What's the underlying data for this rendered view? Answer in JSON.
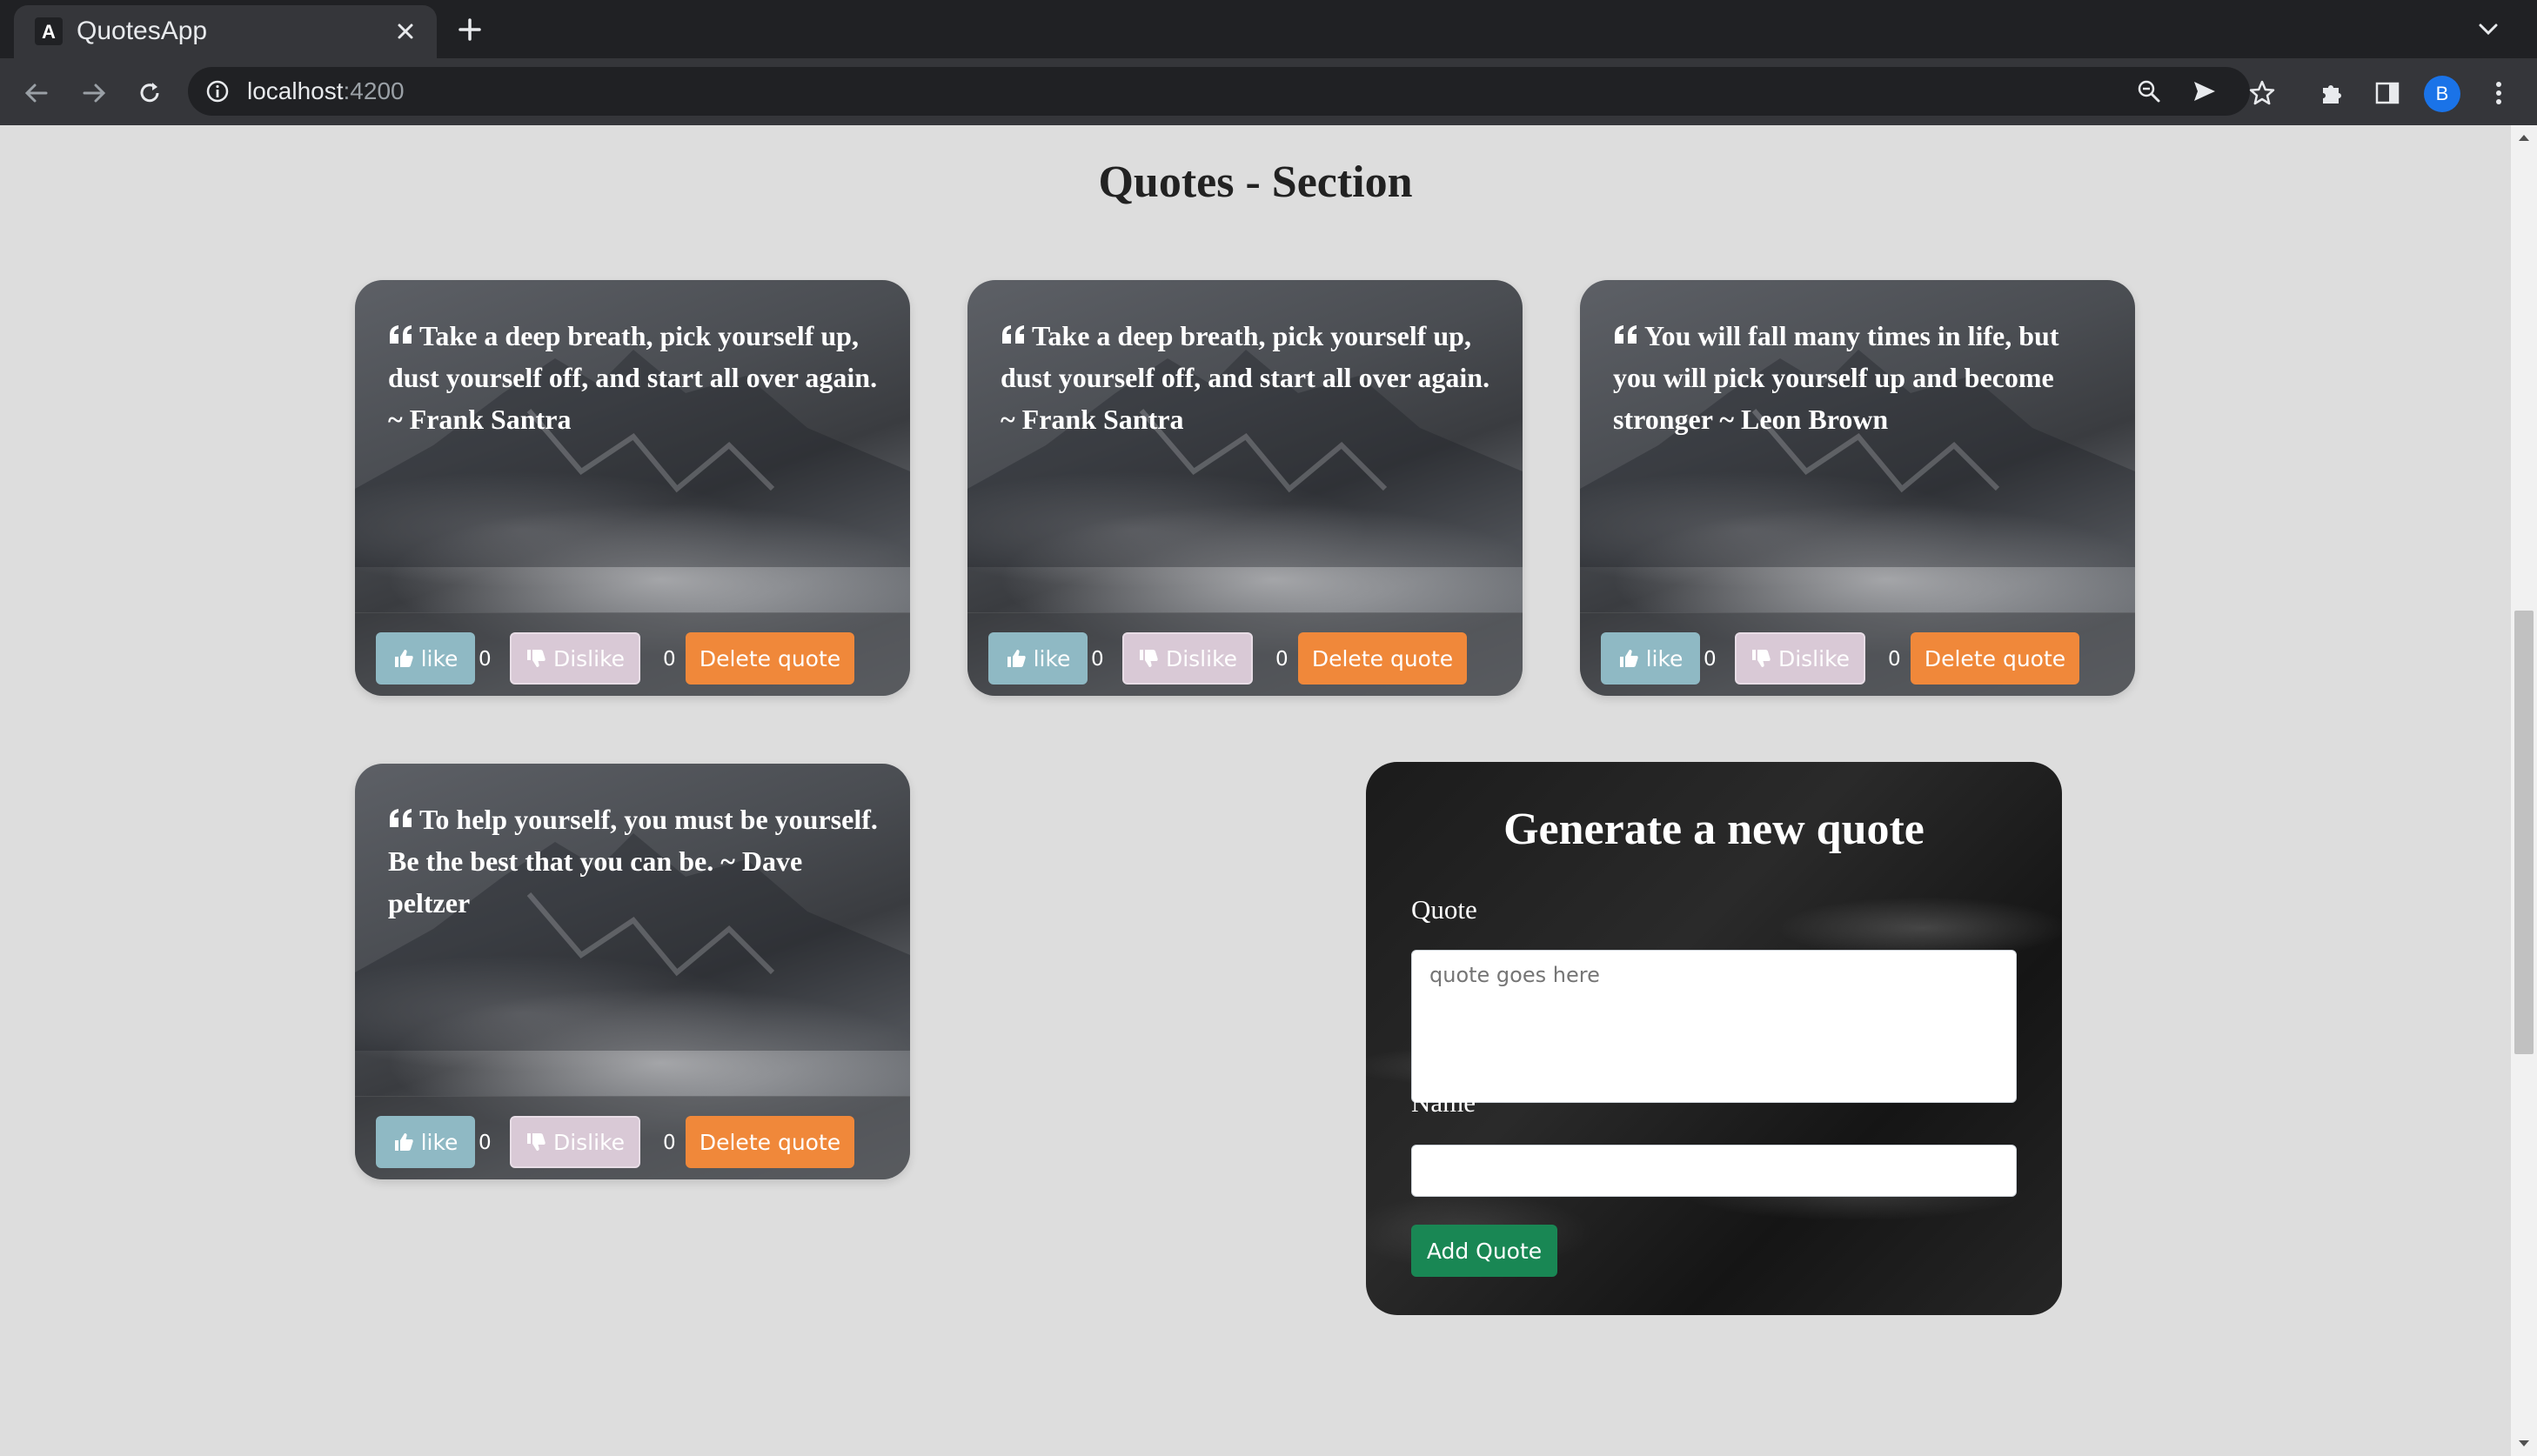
{
  "browser": {
    "tab_title": "QuotesApp",
    "url_host": "localhost",
    "url_port": ":4200",
    "profile_initial": "B"
  },
  "page": {
    "title": "Quotes - Section"
  },
  "quotes": [
    {
      "text": "Take a deep breath, pick yourself up, dust yourself off, and start all over again. ~ Frank Santra",
      "like_label": "like",
      "likes": "0",
      "dislike_label": "Dislike",
      "dislikes": "0",
      "delete_label": "Delete quote"
    },
    {
      "text": "Take a deep breath, pick yourself up, dust yourself off, and start all over again. ~ Frank Santra",
      "like_label": "like",
      "likes": "0",
      "dislike_label": "Dislike",
      "dislikes": "0",
      "delete_label": "Delete quote"
    },
    {
      "text": "You will fall many times in life, but you will pick yourself up and become stronger ~ Leon Brown",
      "like_label": "like",
      "likes": "0",
      "dislike_label": "Dislike",
      "dislikes": "0",
      "delete_label": "Delete quote"
    },
    {
      "text": "To help yourself, you must be yourself. Be the best that you can be. ~ Dave peltzer",
      "like_label": "like",
      "likes": "0",
      "dislike_label": "Dislike",
      "dislikes": "0",
      "delete_label": "Delete quote"
    }
  ],
  "form": {
    "title": "Generate a new quote",
    "quote_label": "Quote",
    "quote_placeholder": "quote goes here",
    "name_label": "Name",
    "submit_label": "Add Quote"
  }
}
